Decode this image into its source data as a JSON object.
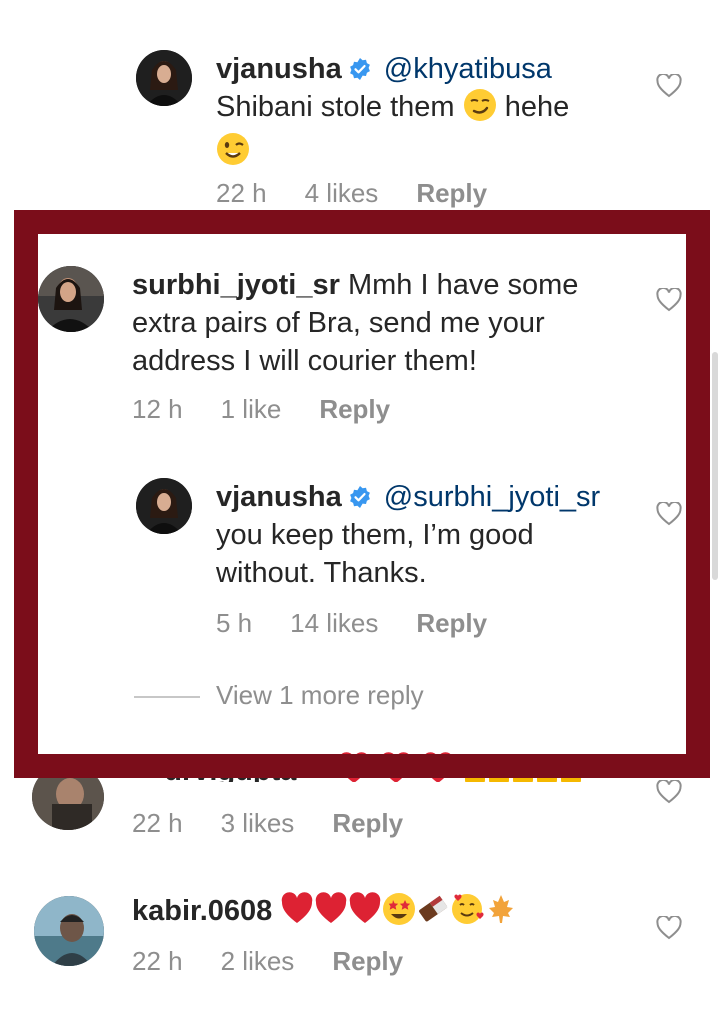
{
  "comments": [
    {
      "username": "vjanusha",
      "verified": true,
      "mention": "@khyatibusa",
      "text_part1": "Shibani stole them",
      "text_part2": "hehe",
      "time": "22 h",
      "likes": "4 likes",
      "reply": "Reply"
    },
    {
      "username": "surbhi_jyoti_sr",
      "text_line1": "Mmh I have some",
      "text_line2": "extra pairs of Bra, send me your",
      "text_line3": "address I will courier them!",
      "time": "12 h",
      "likes": "1 like",
      "reply": "Reply"
    },
    {
      "username": "vjanusha",
      "verified": true,
      "mention": "@surbhi_jyoti_sr",
      "text_line1": "you keep them, I’m good",
      "text_line2": "without. Thanks.",
      "time": "5 h",
      "likes": "14 likes",
      "reply": "Reply"
    },
    {
      "username_partial": "__urvigupta__",
      "time": "22 h",
      "likes": "3 likes",
      "reply": "Reply"
    },
    {
      "username": "kabir.0608",
      "time": "22 h",
      "likes": "2 likes",
      "reply": "Reply"
    }
  ],
  "view_more_replies": "View 1 more reply",
  "colors": {
    "highlight_border": "#7b0d1a",
    "verified_badge": "#3897f0",
    "mention": "#00376b",
    "meta_text": "#8e8e8e"
  },
  "icons": [
    "verified-badge-icon",
    "heart-outline-icon",
    "smirk-emoji-icon",
    "wink-emoji-icon",
    "red-heart-emoji-icon",
    "star-struck-emoji-icon",
    "chocolate-emoji-icon",
    "smiling-hearts-emoji-icon",
    "maple-leaf-emoji-icon",
    "clapping-hands-emoji-icon"
  ]
}
